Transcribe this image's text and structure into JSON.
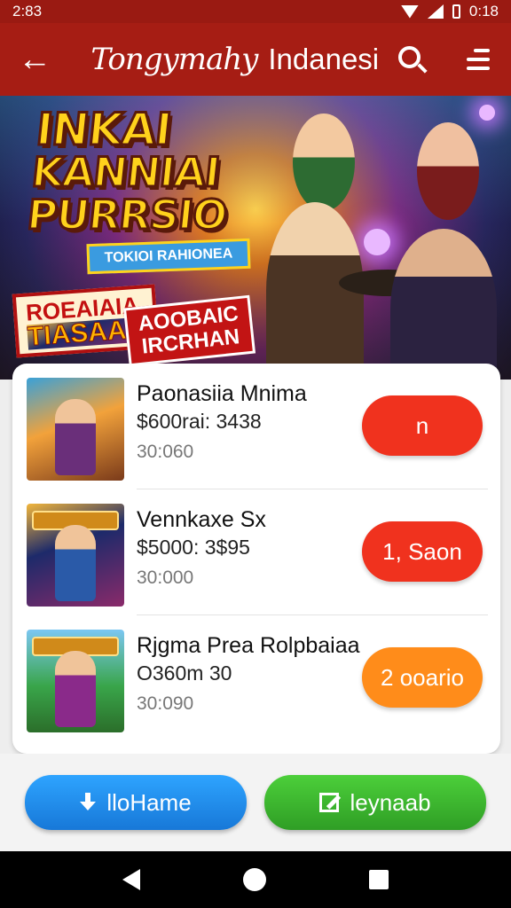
{
  "status_bar": {
    "time": "2:83",
    "clock_right": "0:18"
  },
  "app_bar": {
    "title_script": "Tongymahy",
    "title_text": "Indanesi",
    "back_icon": "arrow-left-icon",
    "search_icon": "search-icon",
    "menu_icon": "menu-icon"
  },
  "banner": {
    "title_lines": [
      "INKAI",
      "KANNIAI",
      "PURRSIO"
    ],
    "subtitle": "TOKIOI RAHIONEA",
    "badge_left_1": "ROEAIAIA",
    "badge_left_2": "TIASAAR",
    "badge_right_1": "AOOBAIC",
    "badge_right_2": "IRCRHAN"
  },
  "games": [
    {
      "title": "Paonasiia Mnima",
      "price": "$600rai: 3438",
      "sub": "30:060",
      "action": "n",
      "action_color": "#f0321e"
    },
    {
      "title": "Vennkaxe Sx",
      "price": "$5000: 3$95",
      "sub": "30:000",
      "action": "1, Saon",
      "action_color": "#f0321e"
    },
    {
      "title": "Rjgma Prea Rolpbaiaa",
      "price": "O360m 30",
      "sub": "30:090",
      "action": "2 ooario",
      "action_color": "#ff8c1a"
    }
  ],
  "bottom_buttons": {
    "left_label": "lloHame",
    "left_icon": "download-icon",
    "right_label": "leynaab",
    "right_icon": "edit-icon"
  },
  "nav": {
    "back": "nav-back-icon",
    "home": "nav-home-icon",
    "recent": "nav-recent-icon"
  }
}
